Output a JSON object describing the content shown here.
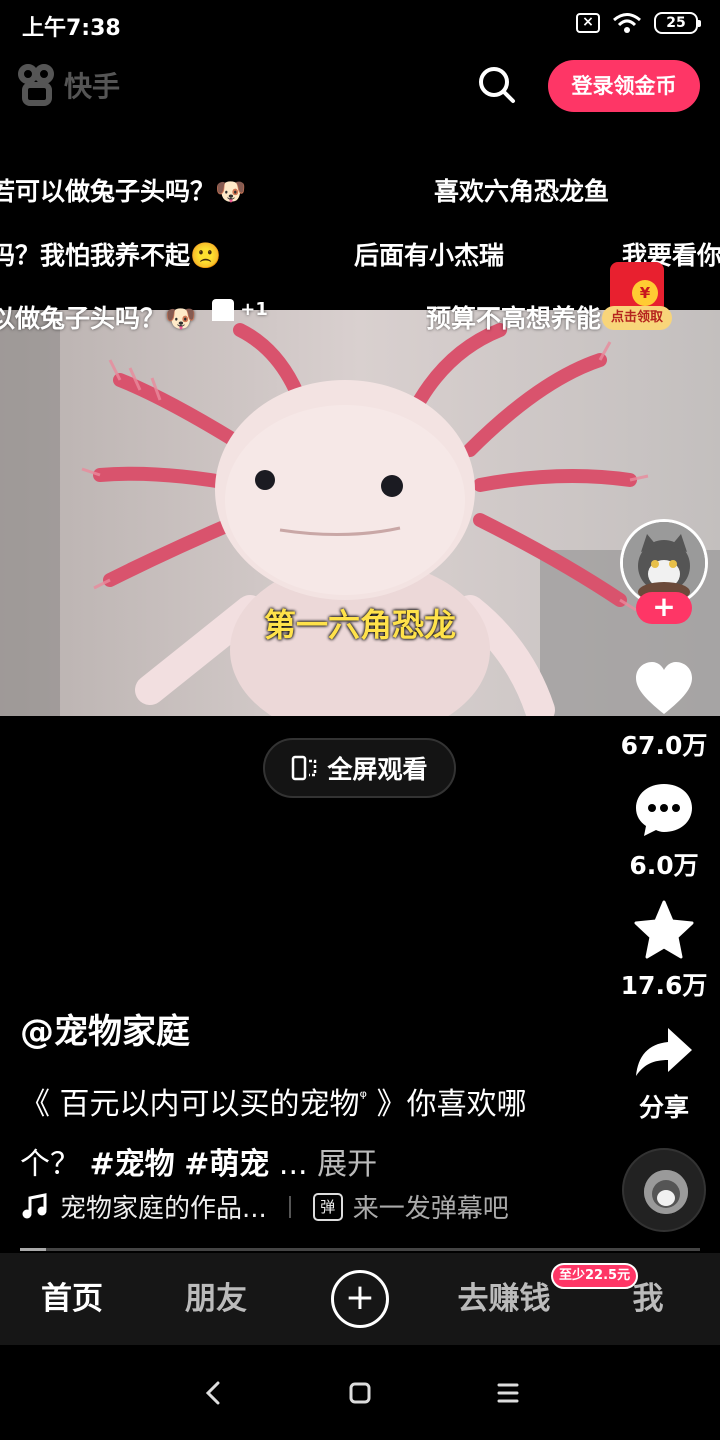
{
  "status_bar": {
    "time": "上午7:38",
    "battery": "25"
  },
  "header": {
    "app_name": "快手",
    "login_button": "登录领金币"
  },
  "danmaku": [
    "若可以做兔子头吗？🐶",
    "喜欢六角恐龙鱼",
    "吗？我怕我养不起🙁",
    "后面有小杰瑞",
    "我要看你",
    "以做兔子头吗？🐶",
    "预算不高想养能"
  ],
  "danmaku_like_count": "+1",
  "video": {
    "subtitle": "第一六角恐龙"
  },
  "red_packet": {
    "label": "点击领取",
    "coin": "¥"
  },
  "fullscreen_button": "全屏观看",
  "rail": {
    "follow": "+",
    "likes": "67.0万",
    "comments": "6.0万",
    "favorites": "17.6万",
    "share": "分享"
  },
  "caption": {
    "author": "@宠物家庭",
    "title_part": "《 百元以内可以买的宠物",
    "search_mark": "ᵠ",
    "title_tail": " 》你喜欢哪个？ ",
    "tag1": "#宠物",
    "tag2": "#萌宠",
    "ellipsis": " ...",
    "expand": " 展开"
  },
  "music_row": {
    "music_text": "宠物家庭的作品...",
    "bullet_icon": "弹",
    "bullet_placeholder": "来一发弹幕吧"
  },
  "bottom_nav": {
    "home": "首页",
    "friends": "朋友",
    "plus": "+",
    "earn": "去赚钱",
    "earn_badge": "至少22.5元",
    "me": "我"
  },
  "system_nav": {
    "back": "‹",
    "home": "▢",
    "menu": "≡"
  },
  "colors": {
    "accent": "#fe3666",
    "subtitle": "#ffe24a",
    "background": "#000000"
  }
}
